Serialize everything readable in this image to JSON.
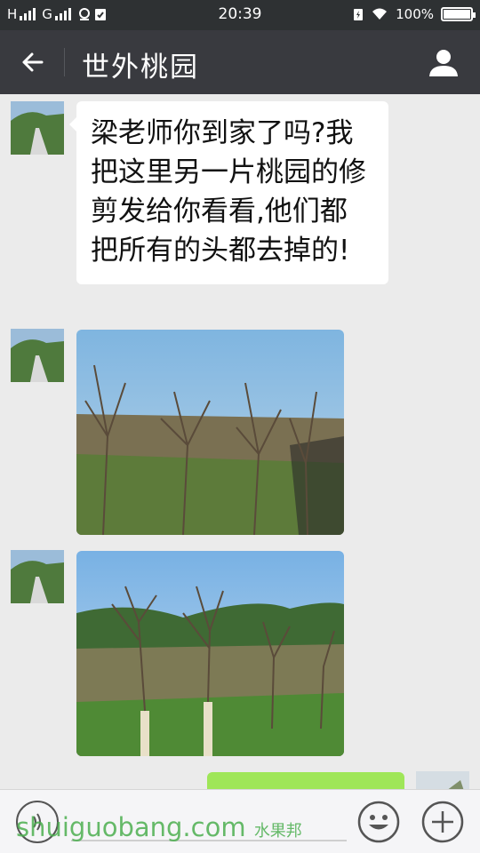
{
  "status_bar": {
    "left_text": "H",
    "left_text2": "G",
    "time": "20:39",
    "battery": "100%",
    "battery_level": 1.0
  },
  "header": {
    "title": "世外桃园",
    "back_icon": "arrow-left-icon",
    "profile_icon": "person-icon"
  },
  "messages": [
    {
      "type": "text",
      "sender": "other",
      "text": "梁老师你到家了吗?我把这里另一片桃园的修剪发给你看看,他们都把所有的头都去掉的!"
    },
    {
      "type": "image",
      "sender": "other",
      "content": "photo of pruned peach orchard"
    },
    {
      "type": "image",
      "sender": "other",
      "content": "photo of pruned peach orchard with hills"
    },
    {
      "type": "text",
      "sender": "self",
      "text": ""
    }
  ],
  "input_bar": {
    "voice_icon": "voice-icon",
    "emoji_icon": "emoji-icon",
    "plus_icon": "plus-icon"
  },
  "watermark": {
    "text": "shuiguobang.com",
    "sub": "水果邦"
  },
  "colors": {
    "status_bar_bg": "#2e3133",
    "title_bar_bg": "#393a3f",
    "chat_bg": "#ebebeb",
    "self_bubble": "#9fe658"
  }
}
